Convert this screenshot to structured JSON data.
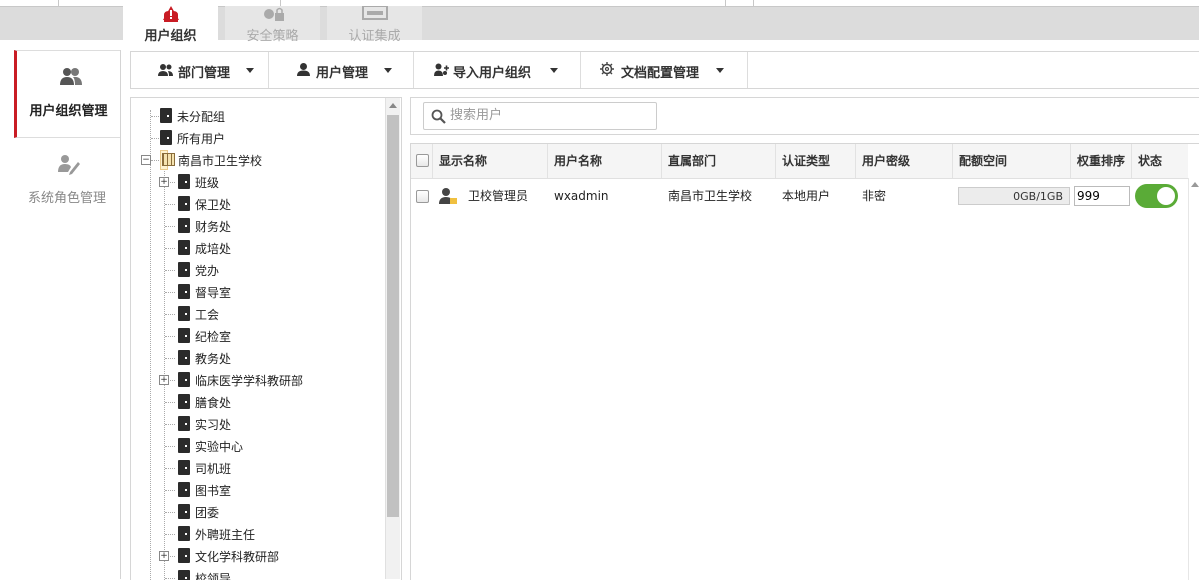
{
  "top_tabs": [
    {
      "label": "用户组织",
      "icon": "user-org-warning-icon",
      "active": true
    },
    {
      "label": "安全策略",
      "icon": "security-policy-icon",
      "active": false
    },
    {
      "label": "认证集成",
      "icon": "auth-integration-icon",
      "active": false
    }
  ],
  "left_nav": [
    {
      "label": "用户组织管理",
      "icon": "users-icon",
      "active": true
    },
    {
      "label": "系统角色管理",
      "icon": "role-edit-icon",
      "active": false
    }
  ],
  "toolbar": {
    "items": [
      {
        "label": "部门管理",
        "icon": "department-icon"
      },
      {
        "label": "用户管理",
        "icon": "user-icon"
      },
      {
        "label": "导入用户组织",
        "icon": "import-users-icon"
      },
      {
        "label": "文档配置管理",
        "icon": "gear-icon"
      }
    ]
  },
  "tree": {
    "nodes": [
      {
        "label": "未分配组",
        "level": 0
      },
      {
        "label": "所有用户",
        "level": 0
      },
      {
        "label": "南昌市卫生学校",
        "level": 0,
        "expanded": true,
        "selected": true,
        "type": "org"
      },
      {
        "label": "班级",
        "level": 1,
        "expandable": true
      },
      {
        "label": "保卫处",
        "level": 1
      },
      {
        "label": "财务处",
        "level": 1
      },
      {
        "label": "成培处",
        "level": 1
      },
      {
        "label": "党办",
        "level": 1
      },
      {
        "label": "督导室",
        "level": 1
      },
      {
        "label": "工会",
        "level": 1
      },
      {
        "label": "纪检室",
        "level": 1
      },
      {
        "label": "教务处",
        "level": 1
      },
      {
        "label": "临床医学学科教研部",
        "level": 1,
        "expandable": true
      },
      {
        "label": "膳食处",
        "level": 1
      },
      {
        "label": "实习处",
        "level": 1
      },
      {
        "label": "实验中心",
        "level": 1
      },
      {
        "label": "司机班",
        "level": 1
      },
      {
        "label": "图书室",
        "level": 1
      },
      {
        "label": "团委",
        "level": 1
      },
      {
        "label": "外聘班主任",
        "level": 1
      },
      {
        "label": "文化学科教研部",
        "level": 1,
        "expandable": true
      },
      {
        "label": "校领导",
        "level": 1
      }
    ]
  },
  "search": {
    "placeholder": "搜索用户",
    "value": ""
  },
  "grid": {
    "columns": [
      "显示名称",
      "用户名称",
      "直属部门",
      "认证类型",
      "用户密级",
      "配额空间",
      "权重排序",
      "状态"
    ],
    "rows": [
      {
        "display_name": "卫校管理员",
        "username": "wxadmin",
        "department": "南昌市卫生学校",
        "auth_type": "本地用户",
        "security_level": "非密",
        "quota": "0GB/1GB",
        "quota_used_fraction": 0,
        "weight": "999",
        "status_on": true
      }
    ]
  },
  "colors": {
    "accent_red": "#c91c24",
    "toggle_green": "#5aab37"
  }
}
